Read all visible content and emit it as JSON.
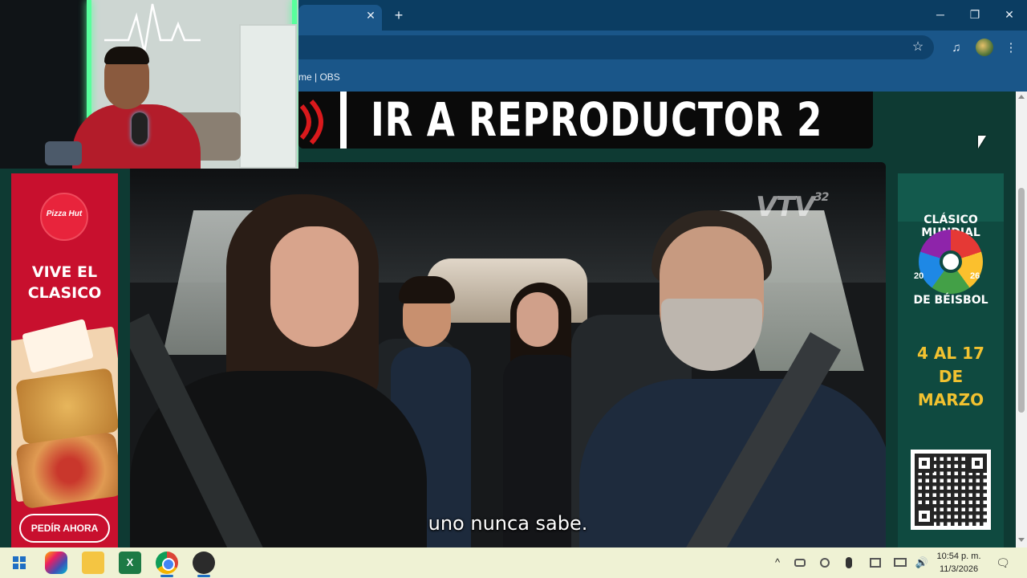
{
  "browser": {
    "tab_close": "✕",
    "new_tab": "+",
    "window_controls": {
      "minimize": "─",
      "maximize": "❐",
      "close": "✕"
    },
    "bookmark_item": "me | OBS",
    "icons": {
      "star": "star-icon",
      "media": "media-control-icon",
      "menu": "kebab-menu-icon"
    },
    "star_glyph": "☆",
    "media_glyph": "♫",
    "menu_glyph": "⋮"
  },
  "player": {
    "banner_text": "IR A REPRODUCTOR 2",
    "accent_color": "#d9191c"
  },
  "video": {
    "channel_logo": "VTV",
    "channel_number": "32",
    "subtitle": "uno nunca sabe."
  },
  "ad_left": {
    "brand": "Pizza Hut",
    "headline_line1": "VIVE EL",
    "headline_line2": "CLASICO",
    "cta": "PEDÍR AHORA",
    "color": "#c8102e"
  },
  "ad_right": {
    "event_top": "CLÁSICO MUNDIAL",
    "event_bottom": "DE BÉISBOL",
    "year_left": "20",
    "year_right": "26",
    "dates_line1": "4 AL 17",
    "dates_line2": "DE",
    "dates_line3": "MARZO",
    "date_color": "#f2c230"
  },
  "taskbar": {
    "excel_glyph": "X",
    "tray": {
      "chevron": "^",
      "volume": "🔊"
    },
    "time": "10:54 p. m.",
    "date": "11/3/2026",
    "notify_glyph": "🗨"
  }
}
